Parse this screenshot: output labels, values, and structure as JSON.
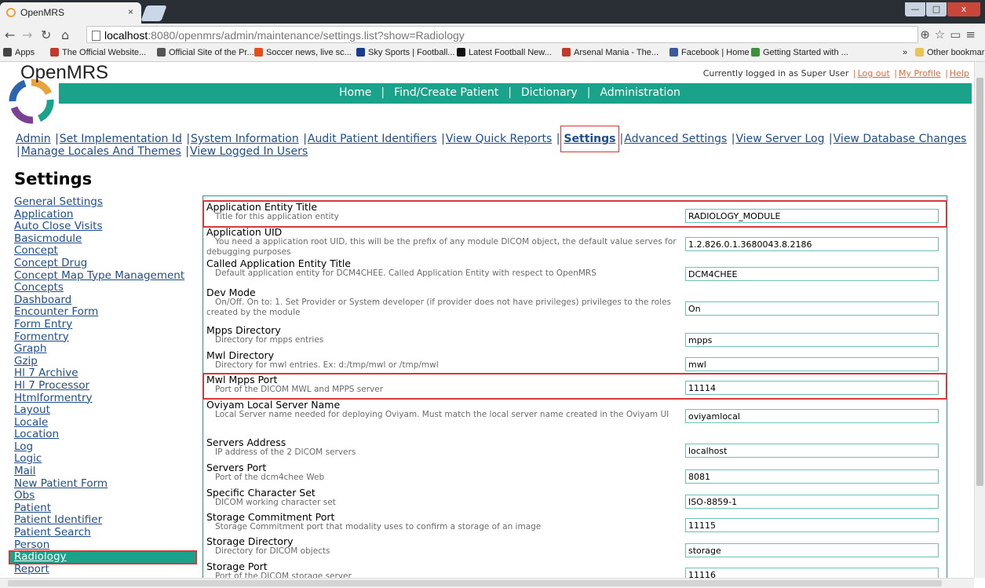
{
  "browser": {
    "tab_title": "OpenMRS",
    "tab_close": "×",
    "url_host": "localhost",
    "url_rest": ":8080/openmrs/admin/maintenance/settings.list?show=Radiology",
    "window_controls": [
      "—",
      "□",
      "x"
    ],
    "bookmarks": [
      {
        "label": "Apps",
        "icon_color": "#444"
      },
      {
        "label": "The Official Website...",
        "icon_color": "#c0392b"
      },
      {
        "label": "Official Site of the Pr...",
        "icon_color": "#555"
      },
      {
        "label": "Soccer news, live sc...",
        "icon_color": "#e84c1b"
      },
      {
        "label": "Sky Sports | Football...",
        "icon_color": "#1a3a8c"
      },
      {
        "label": "Latest Football New...",
        "icon_color": "#111"
      },
      {
        "label": "Arsenal Mania - The...",
        "icon_color": "#c0392b"
      },
      {
        "label": "Facebook | Home",
        "icon_color": "#3b5998"
      },
      {
        "label": "Getting Started with ...",
        "icon_color": "#3d8f3d"
      },
      {
        "label": "»",
        "icon_color": ""
      },
      {
        "label": "Other bookmarks",
        "icon_color": "#e8c35a"
      }
    ]
  },
  "header": {
    "brand": "OpenMRS",
    "logged_in_text": "Currently logged in as Super User",
    "logout": "Log out",
    "my_profile": "My Profile",
    "help": "Help",
    "nav": [
      "Home",
      "Find/Create Patient",
      "Dictionary",
      "Administration"
    ]
  },
  "admin_links": {
    "line1": [
      "Admin",
      "Set Implementation Id",
      "System Information",
      "Audit Patient Identifiers",
      "View Quick Reports",
      "Settings",
      "Advanced Settings",
      "View Server Log",
      "View Database Changes"
    ],
    "line2": [
      "Manage Locales And Themes",
      "View Logged In Users"
    ]
  },
  "page_title": "Settings",
  "sidebar": {
    "items": [
      "General Settings",
      "Application",
      "Auto Close Visits",
      "Basicmodule",
      "Concept",
      "Concept Drug",
      "Concept Map Type Management",
      "Concepts",
      "Dashboard",
      "Encounter Form",
      "Form Entry",
      "Formentry",
      "Graph",
      "Gzip",
      "Hl 7 Archive",
      "Hl 7 Processor",
      "Htmlformentry",
      "Layout",
      "Locale",
      "Location",
      "Log",
      "Logic",
      "Mail",
      "New Patient Form",
      "Obs",
      "Patient",
      "Patient Identifier",
      "Patient Search",
      "Person",
      "Radiology",
      "Report"
    ],
    "selected": "Radiology"
  },
  "settings": [
    {
      "name": "Application Entity Title",
      "desc": "Title for this application entity",
      "value": "RADIOLOGY_MODULE",
      "highlight": true
    },
    {
      "name": "Application UID",
      "desc": "You need a application root UID, this will be the prefix of any module DICOM object, the default value serves for debugging purposes",
      "value": "1.2.826.0.1.3680043.8.2186",
      "highlight": false
    },
    {
      "name": "Called Application Entity Title",
      "desc": "Default application entity for DCM4CHEE. Called Application Entity with respect to OpenMRS",
      "value": "DCM4CHEE",
      "highlight": false
    },
    {
      "name": "Dev Mode",
      "desc": "On/Off. On to: 1. Set Provider or System developer (if provider does not have privileges) privileges to the roles created by the module",
      "value": "On",
      "highlight": false
    },
    {
      "name": "Mpps Directory",
      "desc": "Directory for mpps entries",
      "value": "mpps",
      "highlight": false
    },
    {
      "name": "Mwl Directory",
      "desc": "Directory for mwl entries. Ex: d:/tmp/mwl or /tmp/mwl",
      "value": "mwl",
      "highlight": false
    },
    {
      "name": "Mwl Mpps Port",
      "desc": "Port of the DICOM MWL and MPPS server",
      "value": "11114",
      "highlight": true
    },
    {
      "name": "Oviyam Local Server Name",
      "desc": "Local Server name needed for deploying Oviyam. Must match the local server name created in the Oviyam UI",
      "value": "oviyamlocal",
      "highlight": false
    },
    {
      "name": "Servers Address",
      "desc": "IP address of the 2 DICOM servers",
      "value": "localhost",
      "highlight": false
    },
    {
      "name": "Servers Port",
      "desc": "Port of the dcm4chee Web",
      "value": "8081",
      "highlight": false
    },
    {
      "name": "Specific Character Set",
      "desc": "DICOM working character set",
      "value": "ISO-8859-1",
      "highlight": false
    },
    {
      "name": "Storage Commitment Port",
      "desc": "Storage Commitment port that modality uses to confirm a storage of an image",
      "value": "11115",
      "highlight": false
    },
    {
      "name": "Storage Directory",
      "desc": "Directory for DICOM objects",
      "value": "storage",
      "highlight": false
    },
    {
      "name": "Storage Port",
      "desc": "Port of the DICOM storage server",
      "value": "11116",
      "highlight": false
    }
  ],
  "colors": {
    "accent": "#1aa38a",
    "link": "#1f4e8c",
    "highlight_border": "#d9383a"
  }
}
